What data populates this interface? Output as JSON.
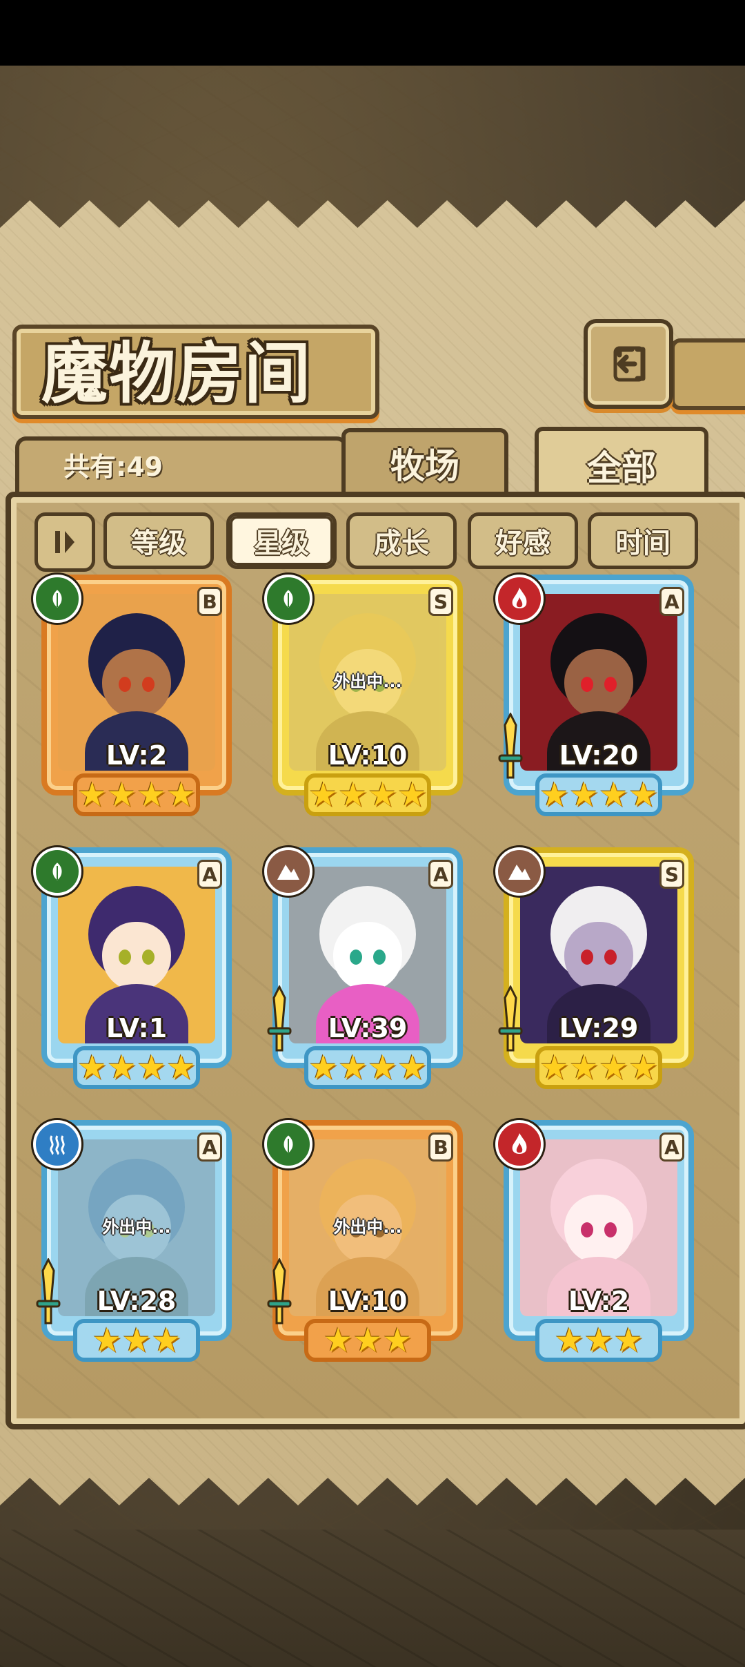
{
  "title": "魔物房间",
  "total_count": "共有:49",
  "tabs": [
    {
      "label": "牧场",
      "active": false
    },
    {
      "label": "全部",
      "active": true
    }
  ],
  "sort_buttons": [
    {
      "label": "等级",
      "active": false
    },
    {
      "label": "星级",
      "active": true
    },
    {
      "label": "成长",
      "active": false
    },
    {
      "label": "好感",
      "active": false
    },
    {
      "label": "时间",
      "active": false
    }
  ],
  "away_label": "外出中...",
  "monsters": [
    {
      "level": "LV:2",
      "rank": "B",
      "element": "leaf-icon",
      "stars": "★★★★",
      "frame": "orange",
      "away": false,
      "equipped": false
    },
    {
      "level": "LV:10",
      "rank": "S",
      "element": "leaf-icon",
      "stars": "★★★★",
      "frame": "yellow",
      "away": true,
      "equipped": false
    },
    {
      "level": "LV:20",
      "rank": "A",
      "element": "fire-icon",
      "stars": "★★★★",
      "frame": "blue",
      "away": false,
      "equipped": true
    },
    {
      "level": "LV:1",
      "rank": "A",
      "element": "leaf-icon",
      "stars": "★★★★",
      "frame": "blue",
      "away": false,
      "equipped": false
    },
    {
      "level": "LV:39",
      "rank": "A",
      "element": "earth-icon",
      "stars": "★★★★",
      "frame": "blue",
      "away": false,
      "equipped": true
    },
    {
      "level": "LV:29",
      "rank": "S",
      "element": "earth-icon",
      "stars": "★★★★",
      "frame": "yellow",
      "away": false,
      "equipped": true
    },
    {
      "level": "LV:28",
      "rank": "A",
      "element": "water-icon",
      "stars": "★★★",
      "frame": "blue",
      "away": true,
      "equipped": true
    },
    {
      "level": "LV:10",
      "rank": "B",
      "element": "leaf-icon",
      "stars": "★★★",
      "frame": "orange",
      "away": true,
      "equipped": true
    },
    {
      "level": "LV:2",
      "rank": "A",
      "element": "fire-icon",
      "stars": "★★★",
      "frame": "blue",
      "away": false,
      "equipped": false
    }
  ],
  "colors": {
    "frame_orange": "#d97a22",
    "frame_yellow": "#d4b01e",
    "frame_blue": "#4ca4cf",
    "parchment": "#c9b486"
  }
}
